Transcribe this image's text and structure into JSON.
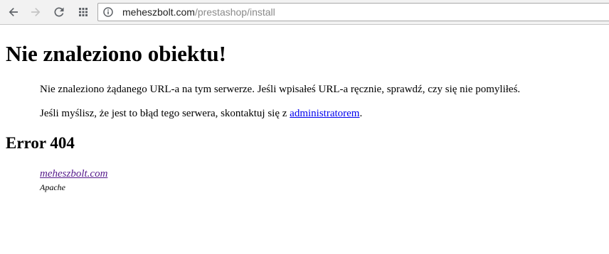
{
  "browser": {
    "url_host": "meheszbolt.com",
    "url_path": "/prestashop/install",
    "icons": {
      "back": "arrow-left-icon",
      "forward": "arrow-right-icon",
      "reload": "reload-icon",
      "apps": "apps-grid-icon",
      "info": "info-icon"
    }
  },
  "page": {
    "title": "Nie znaleziono obiektu!",
    "message": "Nie znaleziono żądanego URL-a na tym serwerze. Jeśli wpisałeś URL-a ręcznie, sprawdź, czy się nie pomyliłeś.",
    "contact_prefix": "Jeśli myślisz, że jest to błąd tego serwera, skontaktuj się z ",
    "contact_link": "administratorem",
    "contact_suffix": ".",
    "error_heading": "Error 404",
    "host_link": "meheszbolt.com",
    "server": "Apache"
  },
  "colors": {
    "link": "#0000ee",
    "visited_link": "#551a8b",
    "toolbar_bg": "#f2f2f2"
  }
}
